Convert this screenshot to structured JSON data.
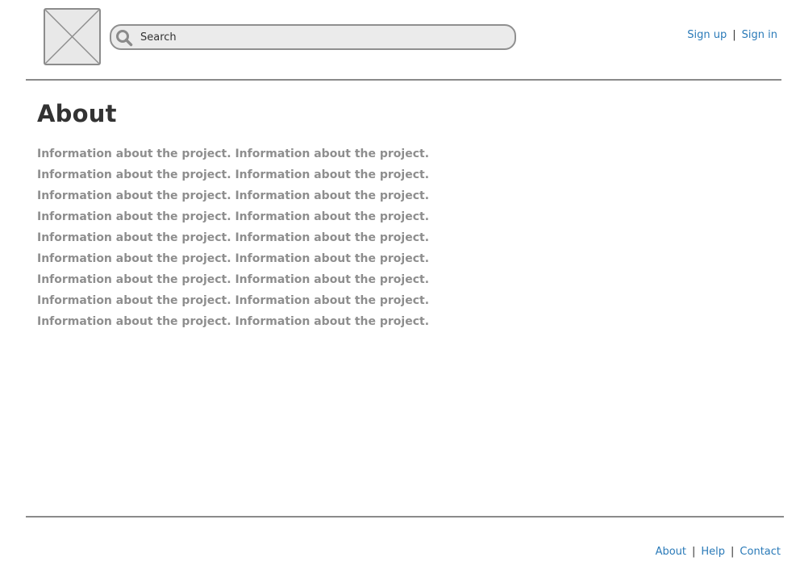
{
  "header": {
    "logo_icon": "image-placeholder-icon",
    "search": {
      "icon": "search-icon",
      "placeholder": "Search",
      "value": ""
    },
    "auth": {
      "signup_label": "Sign up",
      "separator": "|",
      "signin_label": "Sign in"
    }
  },
  "main": {
    "title": "About",
    "body": "Information about the project. Information about the project. Information about the project. Information about the project. Information about the project. Information about the project. Information about the project. Information about the project. Information about the project. Information about the project. Information about the project. Information about the project. Information about the project. Information about the project. Information about the project. Information about the project. Information about the project. Information about the project."
  },
  "footer": {
    "links": [
      "About",
      "Help",
      "Contact"
    ],
    "separator": "|"
  },
  "colors": {
    "link": "#2a7ab8",
    "heading": "#333333",
    "body_text": "#8e8e8e",
    "rule": "#8a8a8a",
    "placeholder_fill": "#e8e8e8"
  }
}
